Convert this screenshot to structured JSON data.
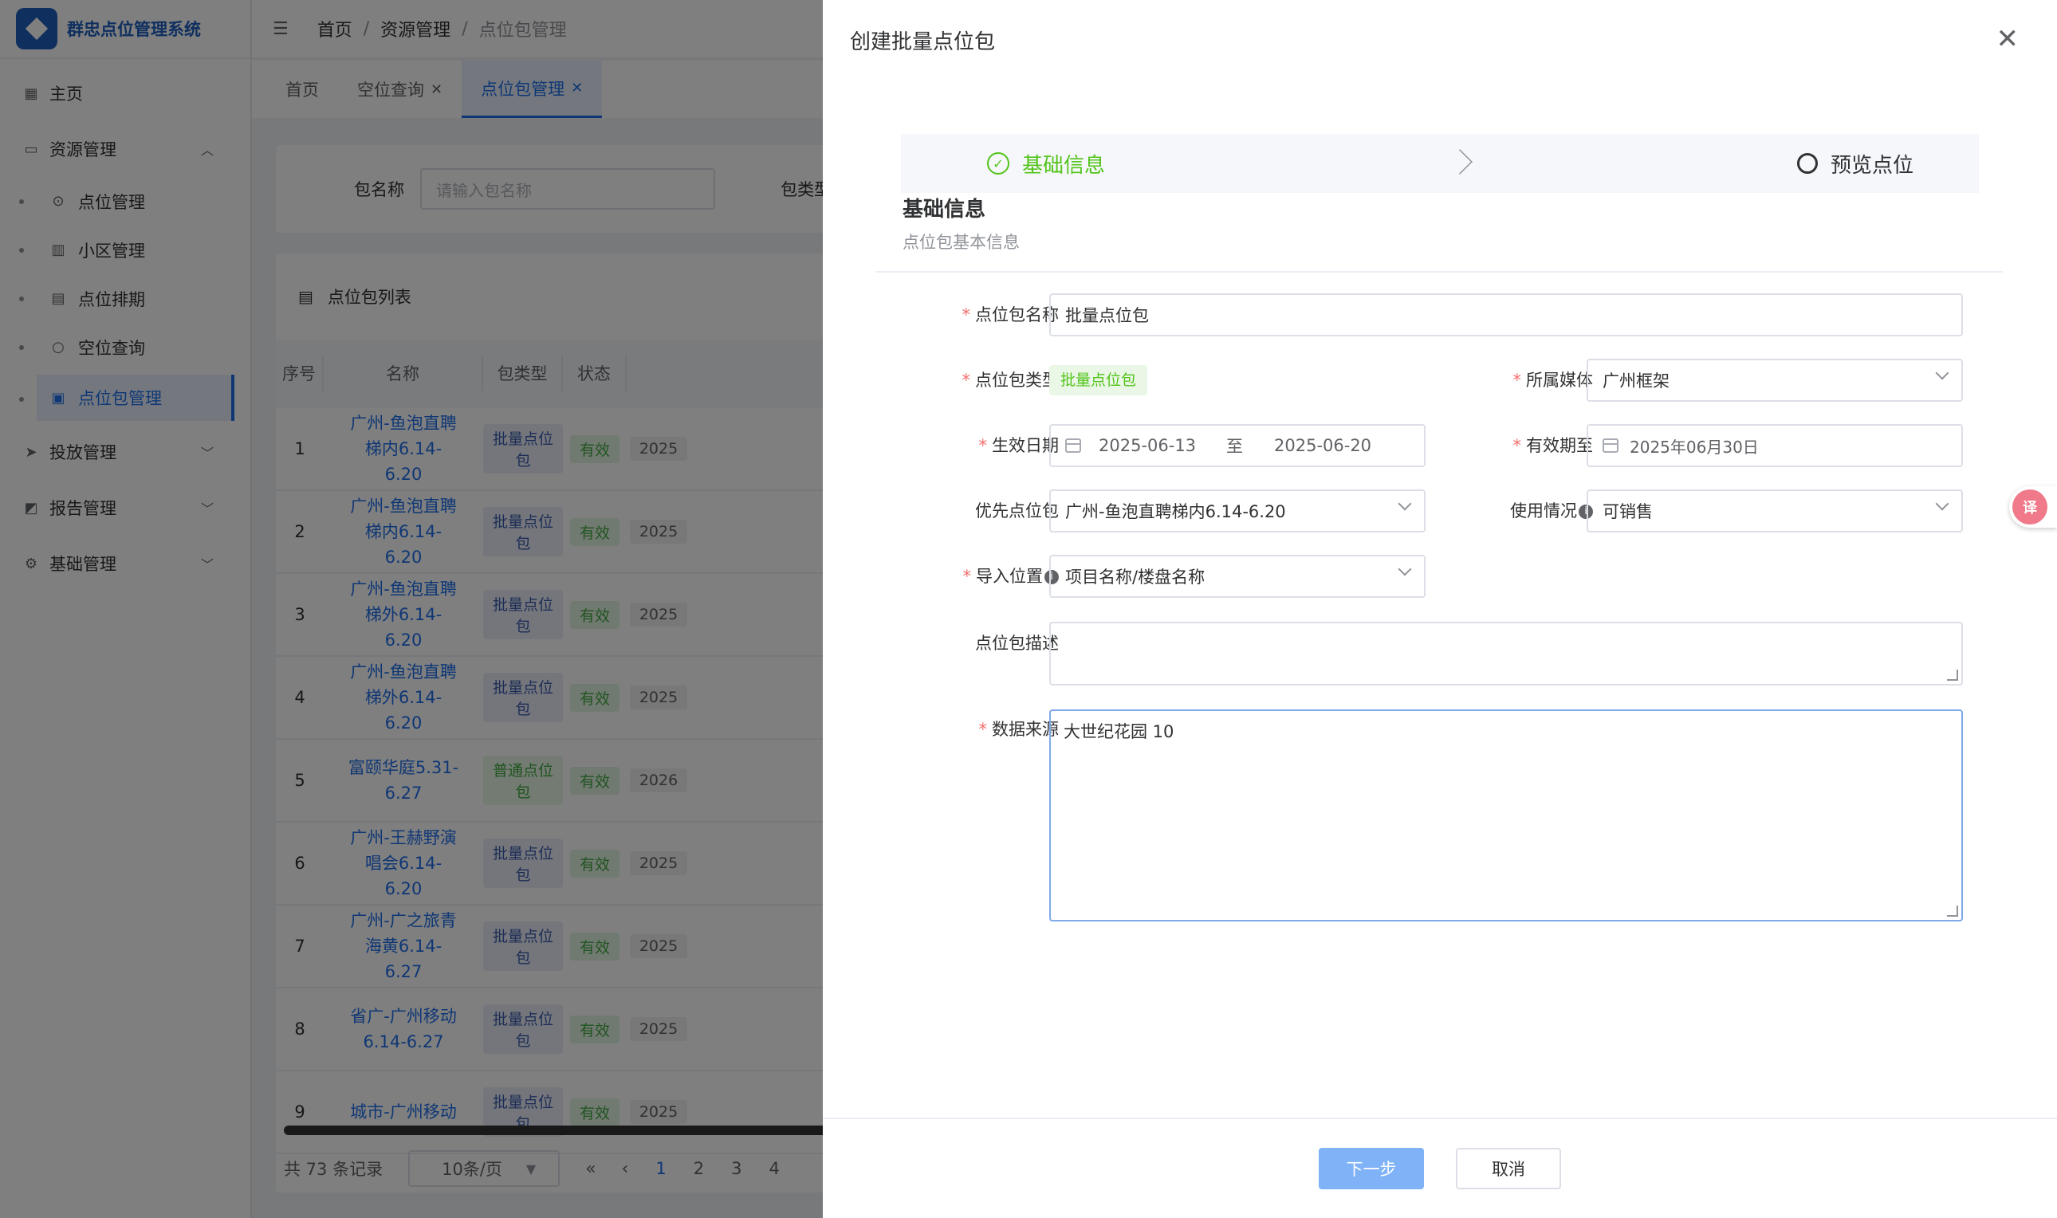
{
  "app": {
    "title": "群忠点位管理系统"
  },
  "sidebar": {
    "home": "主页",
    "resource": {
      "label": "资源管理",
      "items": [
        "点位管理",
        "小区管理",
        "点位排期",
        "空位查询",
        "点位包管理"
      ]
    },
    "delivery": "投放管理",
    "report": "报告管理",
    "basic": "基础管理"
  },
  "breadcrumb": [
    "首页",
    "资源管理",
    "点位包管理"
  ],
  "tabs": [
    {
      "label": "首页"
    },
    {
      "label": "空位查询"
    },
    {
      "label": "点位包管理"
    }
  ],
  "search": {
    "name_label": "包名称",
    "name_placeholder": "请输入包名称",
    "type_label": "包类型"
  },
  "list": {
    "title": "点位包列表",
    "headers": [
      "序号",
      "名称",
      "包类型",
      "状态"
    ],
    "rows": [
      {
        "no": "1",
        "name": "广州-鱼泡直聘梯内6.14-6.20",
        "type": "批量点位包",
        "status": "有效",
        "date": "2025"
      },
      {
        "no": "2",
        "name": "广州-鱼泡直聘梯内6.14-6.20",
        "type": "批量点位包",
        "status": "有效",
        "date": "2025"
      },
      {
        "no": "3",
        "name": "广州-鱼泡直聘梯外6.14-6.20",
        "type": "批量点位包",
        "status": "有效",
        "date": "2025"
      },
      {
        "no": "4",
        "name": "广州-鱼泡直聘梯外6.14-6.20",
        "type": "批量点位包",
        "status": "有效",
        "date": "2025"
      },
      {
        "no": "5",
        "name": "富颐华庭5.31-6.27",
        "type": "普通点位包",
        "status": "有效",
        "date": "2026"
      },
      {
        "no": "6",
        "name": "广州-王赫野演唱会6.14-6.20",
        "type": "批量点位包",
        "status": "有效",
        "date": "2025"
      },
      {
        "no": "7",
        "name": "广州-广之旅青海黄6.14-6.27",
        "type": "批量点位包",
        "status": "有效",
        "date": "2025"
      },
      {
        "no": "8",
        "name": "省广-广州移动6.14-6.27",
        "type": "批量点位包",
        "status": "有效",
        "date": "2025"
      },
      {
        "no": "9",
        "name": "城市-广州移动",
        "type": "批量点位包",
        "status": "有效",
        "date": "2025"
      }
    ],
    "total": "共 73 条记录",
    "page_size": "10条/页",
    "pages": [
      "1",
      "2",
      "3",
      "4"
    ]
  },
  "drawer": {
    "title": "创建批量点位包",
    "steps": {
      "step1": "基础信息",
      "step2": "预览点位"
    },
    "section_title": "基础信息",
    "section_sub": "点位包基本信息",
    "form": {
      "name_label": "点位包名称",
      "name_value": "批量点位包",
      "type_label": "点位包类型",
      "type_value": "批量点位包",
      "media_label": "所属媒体",
      "media_value": "广州框架",
      "date_label": "生效日期",
      "date_start": "2025-06-13",
      "date_to": "至",
      "date_end": "2025-06-20",
      "valid_label": "有效期至",
      "valid_value": "2025年06月30日",
      "priority_label": "优先点位包",
      "priority_value": "广州-鱼泡直聘梯内6.14-6.20",
      "usage_label": "使用情况",
      "usage_value": "可销售",
      "import_label": "导入位置",
      "import_value": "项目名称/楼盘名称",
      "desc_label": "点位包描述",
      "desc_value": "",
      "source_label": "数据来源",
      "source_value": "大世纪花园 10"
    },
    "next": "下一步",
    "cancel": "取消"
  }
}
